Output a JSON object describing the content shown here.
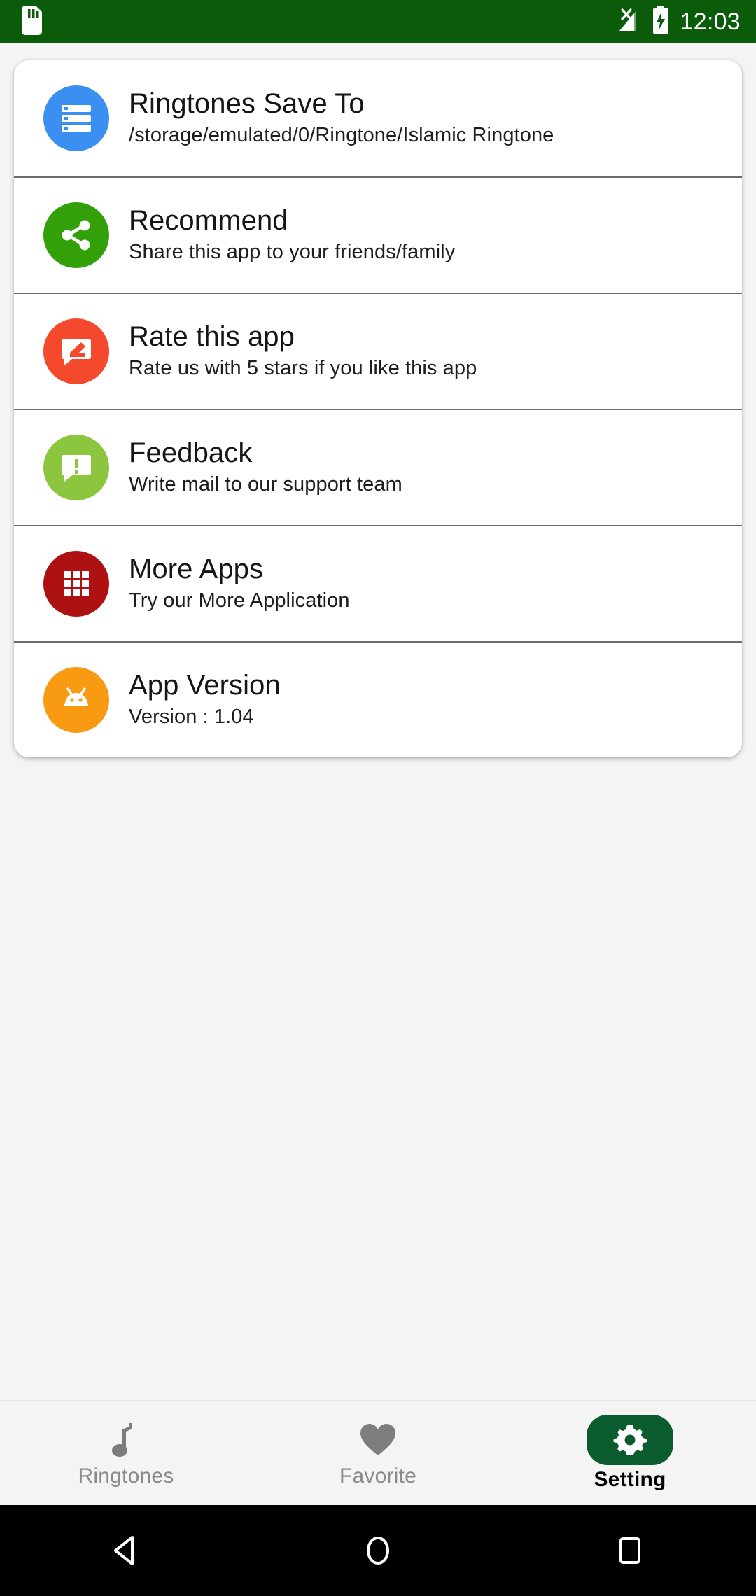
{
  "status_bar": {
    "background_color": "#0a5c0a",
    "time": "12:03",
    "left_icons": [
      "sd-card-icon"
    ],
    "right_icons": [
      "signal-no-service-icon",
      "battery-charging-icon"
    ]
  },
  "settings_list": {
    "items": [
      {
        "title": "Ringtones Save To",
        "subtitle": "/storage/emulated/0/Ringtone/Islamic Ringtone",
        "icon": "storage-server-icon",
        "icon_color": "#3b8ff0"
      },
      {
        "title": "Recommend",
        "subtitle": "Share this app to your friends/family",
        "icon": "share-icon",
        "icon_color": "#33a009"
      },
      {
        "title": "Rate this app",
        "subtitle": "Rate us with 5 stars if you like this app",
        "icon": "rate-edit-bubble-icon",
        "icon_color": "#f4492d"
      },
      {
        "title": "Feedback",
        "subtitle": "Write mail to our support team",
        "icon": "feedback-bubble-icon",
        "icon_color": "#8cc63e"
      },
      {
        "title": "More Apps",
        "subtitle": "Try our More Application",
        "icon": "grid-apps-icon",
        "icon_color": "#ad1111"
      },
      {
        "title": "App Version",
        "subtitle": "Version : 1.04",
        "icon": "android-robot-icon",
        "icon_color": "#f99a13"
      }
    ]
  },
  "bottom_tabs": {
    "active_color": "#0a5c2e",
    "inactive_color": "#8a8a8a",
    "items": [
      {
        "label": "Ringtones",
        "icon": "music-note-icon",
        "active": false
      },
      {
        "label": "Favorite",
        "icon": "heart-icon",
        "active": false
      },
      {
        "label": "Setting",
        "icon": "gear-icon",
        "active": true
      }
    ]
  },
  "system_nav": {
    "background_color": "#000000",
    "buttons": [
      "back-icon",
      "home-icon",
      "recents-icon"
    ]
  }
}
